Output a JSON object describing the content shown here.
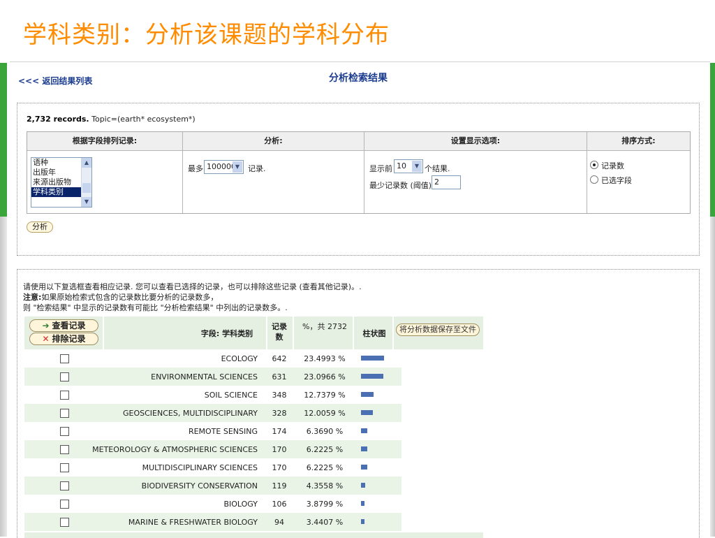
{
  "slide_title": "学科类别：分析该课题的学科分布",
  "header": {
    "back_link": "<<< 返回结果列表",
    "page_title": "分析检索结果"
  },
  "records_line": {
    "count": "2,732 records.",
    "query": " Topic=(earth* ecosystem*)"
  },
  "options_table": {
    "col_field": "根据字段排列记录:",
    "col_analyze": "分析:",
    "col_display": "设置显示选项:",
    "col_sort": "排序方式:",
    "field_list": [
      "语种",
      "出版年",
      "来源出版物",
      "学科类别"
    ],
    "field_selected": "学科类别",
    "analyze_prefix": "最多",
    "analyze_value": "100000",
    "analyze_suffix": "记录.",
    "display_prefix": "显示前",
    "display_value": "10",
    "display_suffix": "个结果.",
    "threshold_label": "最少记录数 (阈值):",
    "threshold_value": "2",
    "sort_options": [
      "记录数",
      "已选字段"
    ],
    "sort_selected": "记录数"
  },
  "analyze_button": "分析",
  "notice": {
    "line1": "请使用以下复选框查看相应记录. 您可以查看已选择的记录，也可以排除这些记录 (查看其他记录)。.",
    "line2_bold": "注意:",
    "line2": "如果原始检索式包含的记录数比要分析的记录数多，",
    "line3": "则 \"检索结果\" 中显示的记录数有可能比 \"分析检索结果\" 中列出的记录数多。."
  },
  "results_header": {
    "view_records": "查看记录",
    "exclude_records": "排除记录",
    "field_col": "字段: 学科类别",
    "count_col": "记录数",
    "pct_col": "%，共 2732",
    "bar_col": "柱状图",
    "save_button": "将分析数据保存至文件"
  },
  "rows": [
    {
      "label": "ECOLOGY",
      "count": "642",
      "pct": "23.4993 %",
      "value": 23.4993
    },
    {
      "label": "ENVIRONMENTAL SCIENCES",
      "count": "631",
      "pct": "23.0966 %",
      "value": 23.0966
    },
    {
      "label": "SOIL SCIENCE",
      "count": "348",
      "pct": "12.7379 %",
      "value": 12.7379
    },
    {
      "label": "GEOSCIENCES, MULTIDISCIPLINARY",
      "count": "328",
      "pct": "12.0059 %",
      "value": 12.0059
    },
    {
      "label": "REMOTE SENSING",
      "count": "174",
      "pct": "6.3690 %",
      "value": 6.369
    },
    {
      "label": "METEOROLOGY & ATMOSPHERIC SCIENCES",
      "count": "170",
      "pct": "6.2225 %",
      "value": 6.2225
    },
    {
      "label": "MULTIDISCIPLINARY SCIENCES",
      "count": "170",
      "pct": "6.2225 %",
      "value": 6.2225
    },
    {
      "label": "BIODIVERSITY CONSERVATION",
      "count": "119",
      "pct": "4.3558 %",
      "value": 4.3558
    },
    {
      "label": "BIOLOGY",
      "count": "106",
      "pct": "3.8799 %",
      "value": 3.8799
    },
    {
      "label": "MARINE & FRESHWATER BIOLOGY",
      "count": "94",
      "pct": "3.4407 %",
      "value": 3.4407
    }
  ],
  "colors": {
    "title": "#ff8c00",
    "bar": "#4a6fb3",
    "row_alt": "#e9f3e6",
    "accent_green": "#3aa53a"
  }
}
